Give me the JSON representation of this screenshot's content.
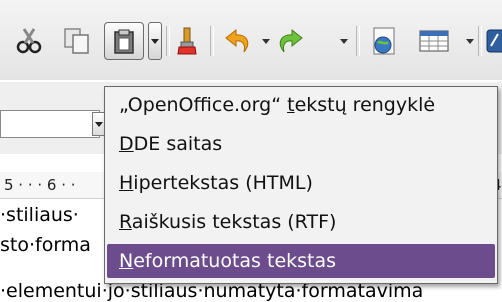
{
  "toolbar": {
    "buttons": [
      {
        "name": "cut-icon"
      },
      {
        "name": "copy-icon"
      },
      {
        "name": "paste-icon"
      },
      {
        "name": "clone-formatting-icon"
      },
      {
        "name": "undo-icon"
      },
      {
        "name": "redo-icon"
      },
      {
        "name": "navigator-icon"
      },
      {
        "name": "table-icon"
      }
    ]
  },
  "ruler": {
    "text": "5 · · · 6 · ·",
    "right": "4"
  },
  "document": {
    "line1": "·stiliaus·",
    "line2": "sto·forma",
    "line3": "·elementui·jo·stiliaus·numatyta·formatavima"
  },
  "paste_menu": {
    "items": [
      {
        "prefix": "„OpenOffice.org“ ",
        "mnemonic": "t",
        "rest": "ekstų rengyklė"
      },
      {
        "prefix": "",
        "mnemonic": "D",
        "rest": "DE saitas"
      },
      {
        "prefix": "",
        "mnemonic": "H",
        "rest": "ipertekstas (HTML)"
      },
      {
        "prefix": "",
        "mnemonic": "R",
        "rest": "aiškusis tekstas (RTF)"
      },
      {
        "prefix": "",
        "mnemonic": "N",
        "rest": "eformatuotas tekstas"
      }
    ],
    "highlighted_index": 4,
    "highlight_color": "#6c4c8c"
  }
}
